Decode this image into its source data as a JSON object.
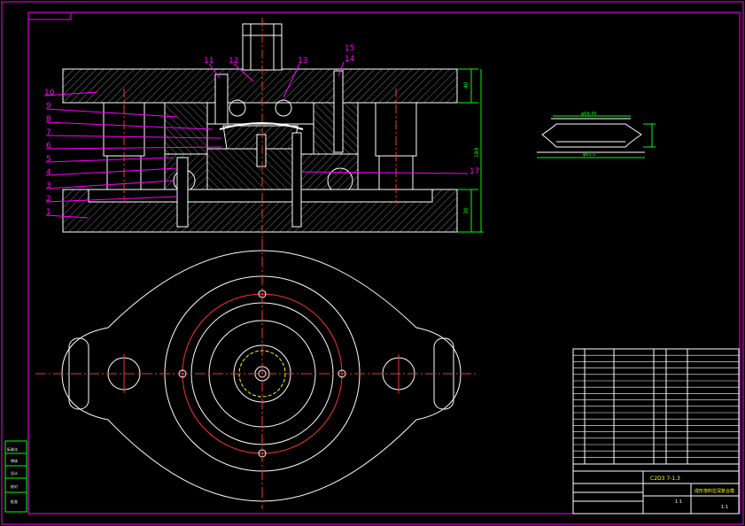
{
  "colors": {
    "background": "#000000",
    "frame": "#ff00ff",
    "hatch": "#7a7a7a",
    "outline": "#ffffff",
    "centerline": "#ff3030",
    "dimension": "#00ff00",
    "hidden": "#ffff00",
    "title_text": "#ffff00",
    "leader": "#ff00ff"
  },
  "part_numbers": [
    "1",
    "2",
    "3",
    "4",
    "5",
    "6",
    "7",
    "8",
    "9",
    "10",
    "11",
    "12",
    "13",
    "14",
    "15",
    "17"
  ],
  "dimensions": {
    "top_plate_height": "40",
    "base_plate_height": "30",
    "total_height": "189",
    "part_width_top": "φ66.45",
    "part_width_bottom": "φ65.5"
  },
  "title_block": {
    "drawing_code": "C2D3 7-1.3",
    "drawing_name": "成形落料拉深复合模",
    "sheet": "1 1",
    "scale": "1:1"
  },
  "left_stamps": [
    "标准化",
    "审核",
    "设计",
    "校对",
    "批准"
  ]
}
